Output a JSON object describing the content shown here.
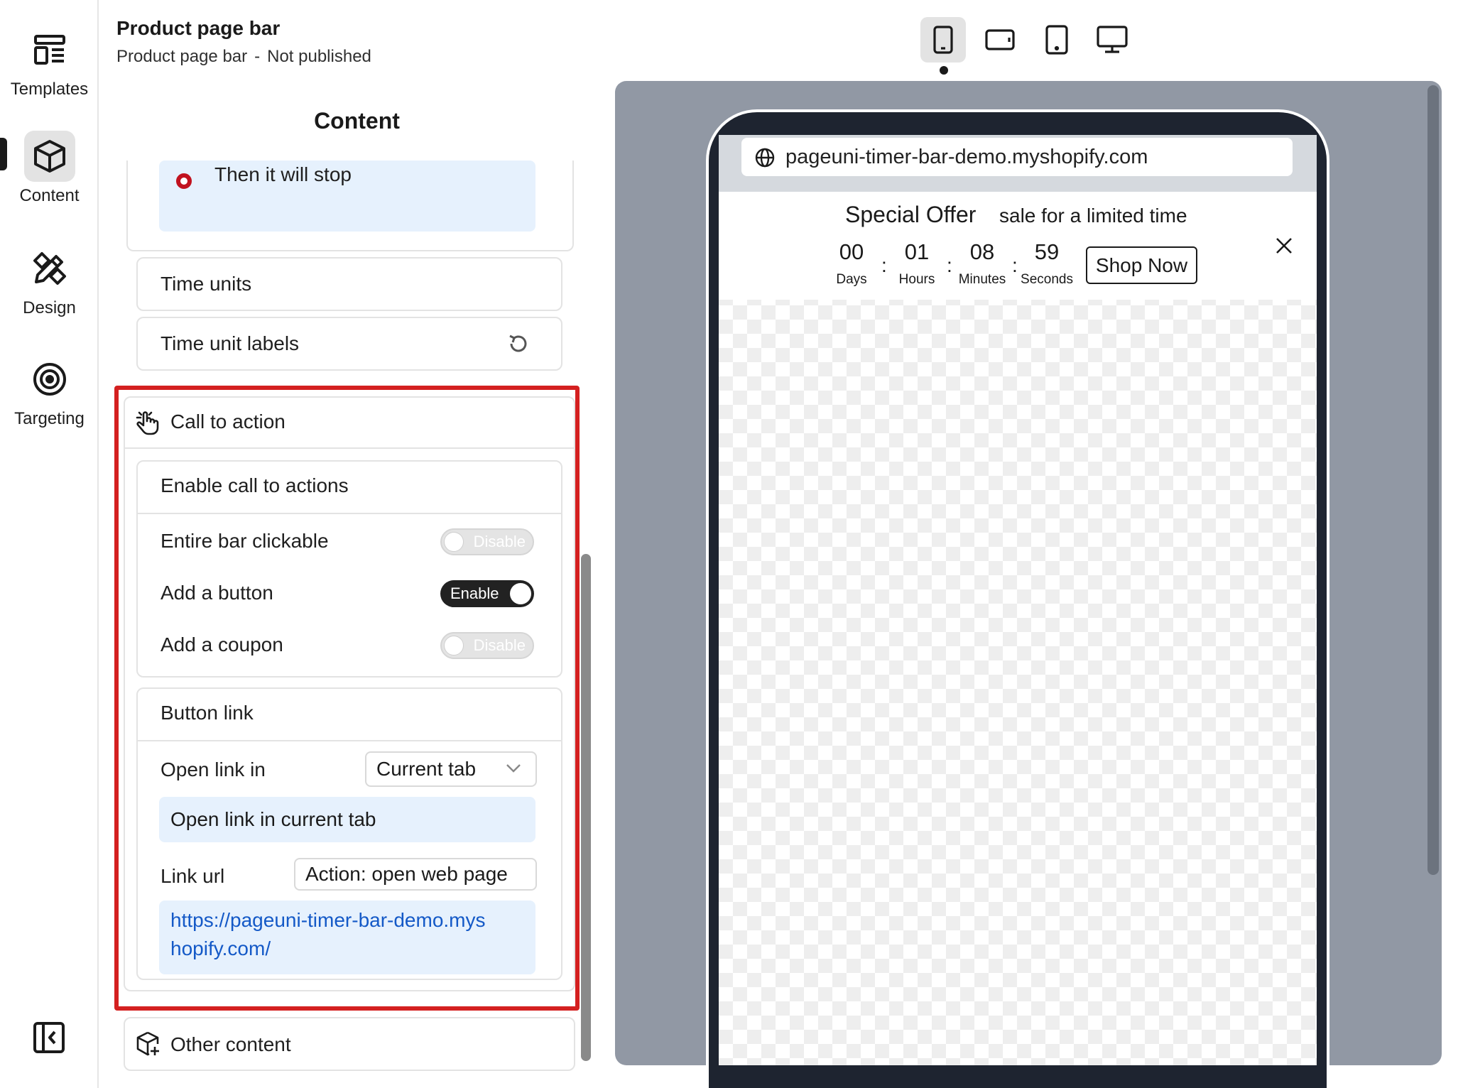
{
  "rail": {
    "items": [
      {
        "label": "Templates",
        "icon": "templates-icon"
      },
      {
        "label": "Content",
        "icon": "cube-icon"
      },
      {
        "label": "Design",
        "icon": "design-tools-icon"
      },
      {
        "label": "Targeting",
        "icon": "target-icon"
      }
    ],
    "active": "Content",
    "collapse_icon": "sidebar-collapse-icon"
  },
  "header": {
    "title": "Product page bar",
    "subtitle_name": "Product page bar",
    "subtitle_separator": "-",
    "subtitle_status": "Not published"
  },
  "panel": {
    "title": "Content",
    "stop_option": "Then it will stop",
    "time_units": "Time units",
    "time_unit_labels": "Time unit labels",
    "cta": {
      "title": "Call to action",
      "enable_section": "Enable call to actions",
      "entire_bar_clickable": {
        "label": "Entire bar clickable",
        "state": "Disable"
      },
      "add_button": {
        "label": "Add a button",
        "state": "Enable"
      },
      "add_coupon": {
        "label": "Add a coupon",
        "state": "Disable"
      },
      "button_link_section": "Button link",
      "open_link_in": {
        "label": "Open link in",
        "value": "Current tab"
      },
      "open_link_info": "Open link in current tab",
      "link_url": {
        "label": "Link url",
        "value": "Action: open web page"
      },
      "url_line1": "https://pageuni-timer-bar-demo.mys",
      "url_line2": "hopify.com/"
    },
    "other_content": "Other content"
  },
  "devices": [
    "mobile-portrait",
    "mobile-landscape",
    "tablet",
    "desktop"
  ],
  "preview": {
    "url": "pageuni-timer-bar-demo.myshopify.com",
    "bar": {
      "title": "Special Offer",
      "subtitle": "sale for a limited time",
      "countdown": [
        {
          "value": "00",
          "label": "Days"
        },
        {
          "value": "01",
          "label": "Hours"
        },
        {
          "value": "08",
          "label": "Minutes"
        },
        {
          "value": "59",
          "label": "Seconds"
        }
      ],
      "separator": ":",
      "button": "Shop Now"
    }
  },
  "colors": {
    "highlight": "#d42020",
    "radio": "#c1121f",
    "info_bg": "#e6f1fd",
    "link": "#1459c7"
  }
}
